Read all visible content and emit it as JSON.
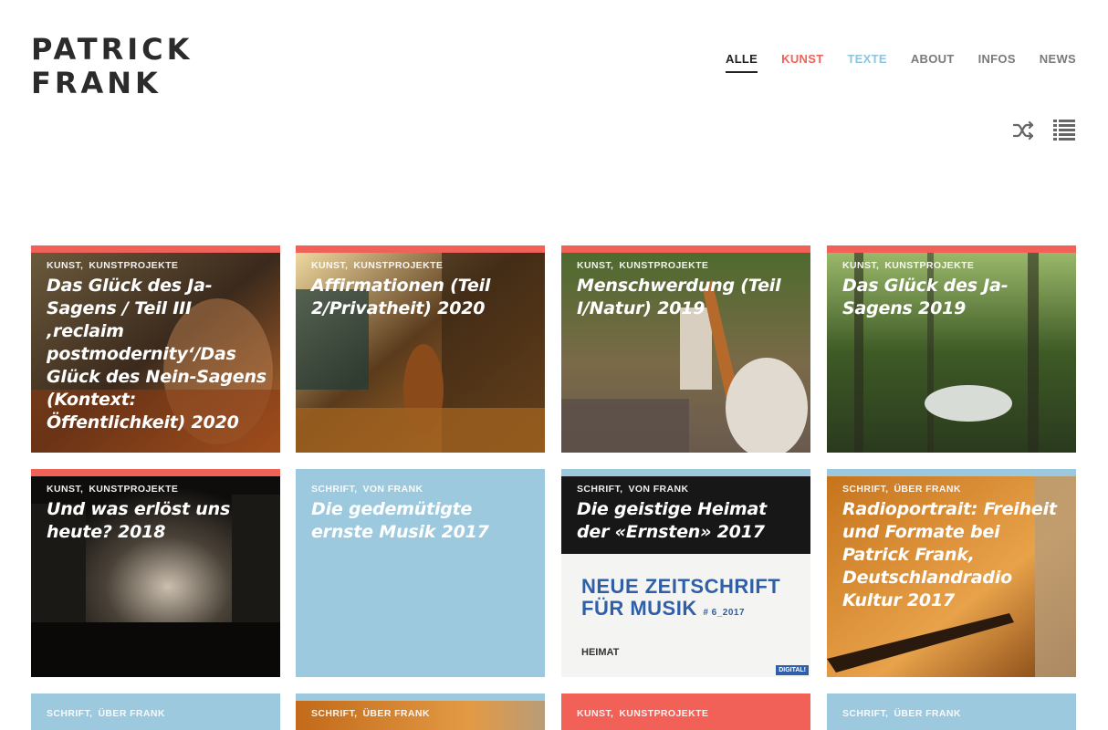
{
  "logo": {
    "line1": "PATRICK",
    "line2": "FRANK"
  },
  "nav": [
    {
      "label": "ALLE"
    },
    {
      "label": "KUNST"
    },
    {
      "label": "TEXTE"
    },
    {
      "label": "ABOUT"
    },
    {
      "label": "INFOS"
    },
    {
      "label": "NEWS"
    }
  ],
  "tools": {
    "shuffle_icon": "shuffle-icon",
    "list_icon": "list-view-icon"
  },
  "colors": {
    "kunst": "#f26157",
    "schrift": "#9dc9df",
    "ink": "#2b2b2b"
  },
  "tiles": [
    {
      "cat1": "KUNST,",
      "cat2": "KUNSTPROJEKTE",
      "title": "Das Glück des Ja-Sagens / Teil III ‚reclaim postmodernity‘/Das Glück des Nein-Sagens (Kontext: Öffentlichkeit) 2020"
    },
    {
      "cat1": "KUNST,",
      "cat2": "KUNSTPROJEKTE",
      "title": "Affirmationen (Teil 2/Privatheit) 2020"
    },
    {
      "cat1": "KUNST,",
      "cat2": "KUNSTPROJEKTE",
      "title": "Menschwerdung (Teil I/Natur) 2019"
    },
    {
      "cat1": "KUNST,",
      "cat2": "KUNSTPROJEKTE",
      "title": "Das Glück des Ja-Sagens 2019"
    },
    {
      "cat1": "KUNST,",
      "cat2": "KUNSTPROJEKTE",
      "title": "Und was erlöst uns heute? 2018"
    },
    {
      "cat1": "SCHRIFT,",
      "cat2": "VON FRANK",
      "title": "Die gedemütigte ernste Musik 2017"
    },
    {
      "cat1": "SCHRIFT,",
      "cat2": "VON FRANK",
      "title": "Die geistige Heimat der «Ernsten» 2017"
    },
    {
      "cat1": "SCHRIFT,",
      "cat2": "ÜBER FRANK",
      "title": "Radioportrait: Freiheit und Formate bei Patrick Frank, Deutschlandradio Kultur 2017"
    },
    {
      "cat1": "SCHRIFT,",
      "cat2": "ÜBER FRANK",
      "title": ""
    },
    {
      "cat1": "SCHRIFT,",
      "cat2": "ÜBER FRANK",
      "title": ""
    },
    {
      "cat1": "KUNST,",
      "cat2": "KUNSTPROJEKTE",
      "title": ""
    },
    {
      "cat1": "SCHRIFT,",
      "cat2": "ÜBER FRANK",
      "title": ""
    }
  ],
  "magazine": {
    "line1": "NEUE ZEITSCHRIFT",
    "line2": "FÜR MUSIK",
    "issue": "# 6_2017",
    "section": "HEIMAT",
    "badge": "DIGITAL!"
  }
}
